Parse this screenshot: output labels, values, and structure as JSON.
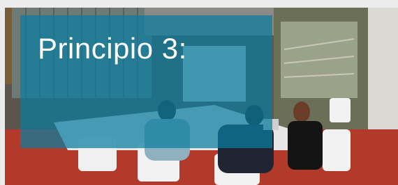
{
  "slide": {
    "title": "Principio 3:",
    "overlay_color": "#0a7da0"
  }
}
